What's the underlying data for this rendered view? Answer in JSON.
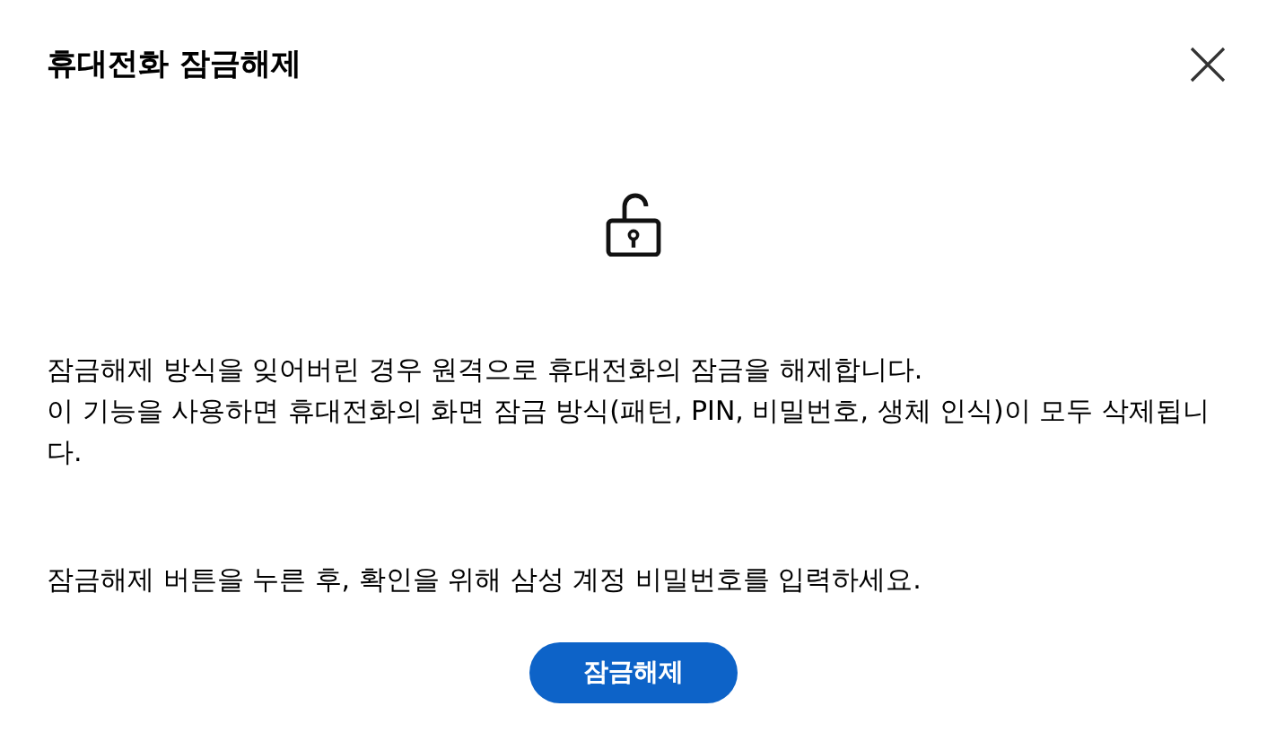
{
  "dialog": {
    "title": "휴대전화 잠금해제",
    "paragraphs": [
      "잠금해제 방식을 잊어버린 경우 원격으로 휴대전화의 잠금을 해제합니다.",
      "이 기능을 사용하면 휴대전화의 화면 잠금 방식(패턴, PIN, 비밀번호, 생체 인식)이 모두 삭제됩니다."
    ],
    "instruction": "잠금해제 버튼을 누른 후, 확인을 위해 삼성 계정 비밀번호를 입력하세요.",
    "button": "잠금해제"
  }
}
